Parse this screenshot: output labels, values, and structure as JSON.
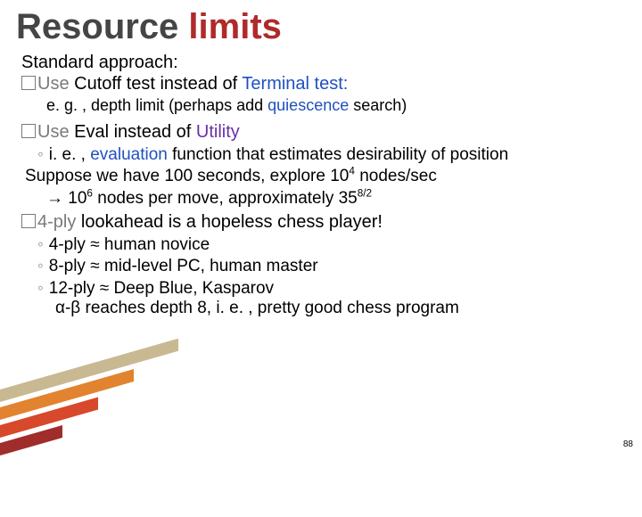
{
  "title": {
    "plain": "Resource ",
    "accent": "limits"
  },
  "intro": "Standard approach:",
  "b1": {
    "use": "Use",
    "seg1": " Cutoff test instead of ",
    "term": "Terminal test:",
    "note_a": "e. g. , depth limit (perhaps add ",
    "note_b": "quiescence",
    "note_c": " search)"
  },
  "b2": {
    "use": "Use",
    "seg1": " Eval instead of ",
    "util": "Utility",
    "s1a": "i. e. , ",
    "s1b": "evaluation",
    "s1c": " function that estimates desirability of position",
    "s2_pre": "Suppose we have 100 seconds, explore 10",
    "s2_exp1": "4",
    "s2_mid": " nodes/sec",
    "s3_arrow": "→",
    "s3_pre": " 10",
    "s3_exp2": "6",
    "s3_mid": " nodes per move, approximately 35",
    "s3_exp3": "8/2"
  },
  "b3": {
    "lead": "4-ply",
    "rest": " lookahead is a hopeless chess player!",
    "s1": "4-ply ≈ human novice",
    "s2": "8-ply ≈ mid-level PC, human master",
    "s3": "12-ply ≈ Deep Blue, Kasparov",
    "s4": "α-β reaches depth 8, i. e. , pretty good chess program"
  },
  "page": "88"
}
